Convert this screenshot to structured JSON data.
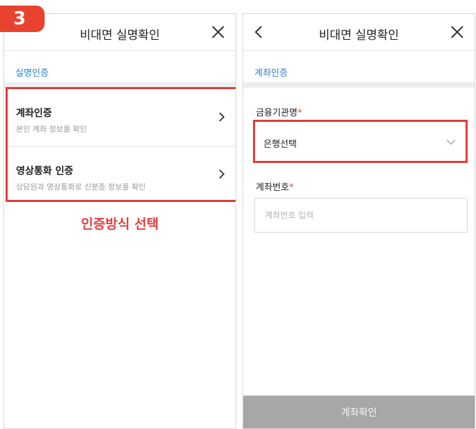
{
  "step_number": "3",
  "left": {
    "title": "비대면 실명확인",
    "section_label": "실명인증",
    "options": [
      {
        "title": "계좌인증",
        "description": "본인 계좌 정보를 확인"
      },
      {
        "title": "영상통화 인증",
        "description": "상담원과 영상통화로 신분증 정보를 확인"
      }
    ],
    "caption": "인증방식 선택"
  },
  "right": {
    "title": "비대면 실명확인",
    "section_label": "계좌인증",
    "bank_field": {
      "label": "금융기관명",
      "required_mark": "*",
      "value": "은행선택"
    },
    "account_field": {
      "label": "계좌번호",
      "required_mark": "*",
      "placeholder": "계좌번호 입력",
      "value": ""
    },
    "confirm_button": "계좌확인"
  },
  "colors": {
    "badge": "#e8432e",
    "highlight": "#e23b3b",
    "link_blue": "#2c7ec8",
    "disabled_button": "#a7a7a7"
  },
  "icons": [
    "close-icon",
    "back-icon",
    "chevron-right-icon",
    "chevron-down-icon"
  ]
}
